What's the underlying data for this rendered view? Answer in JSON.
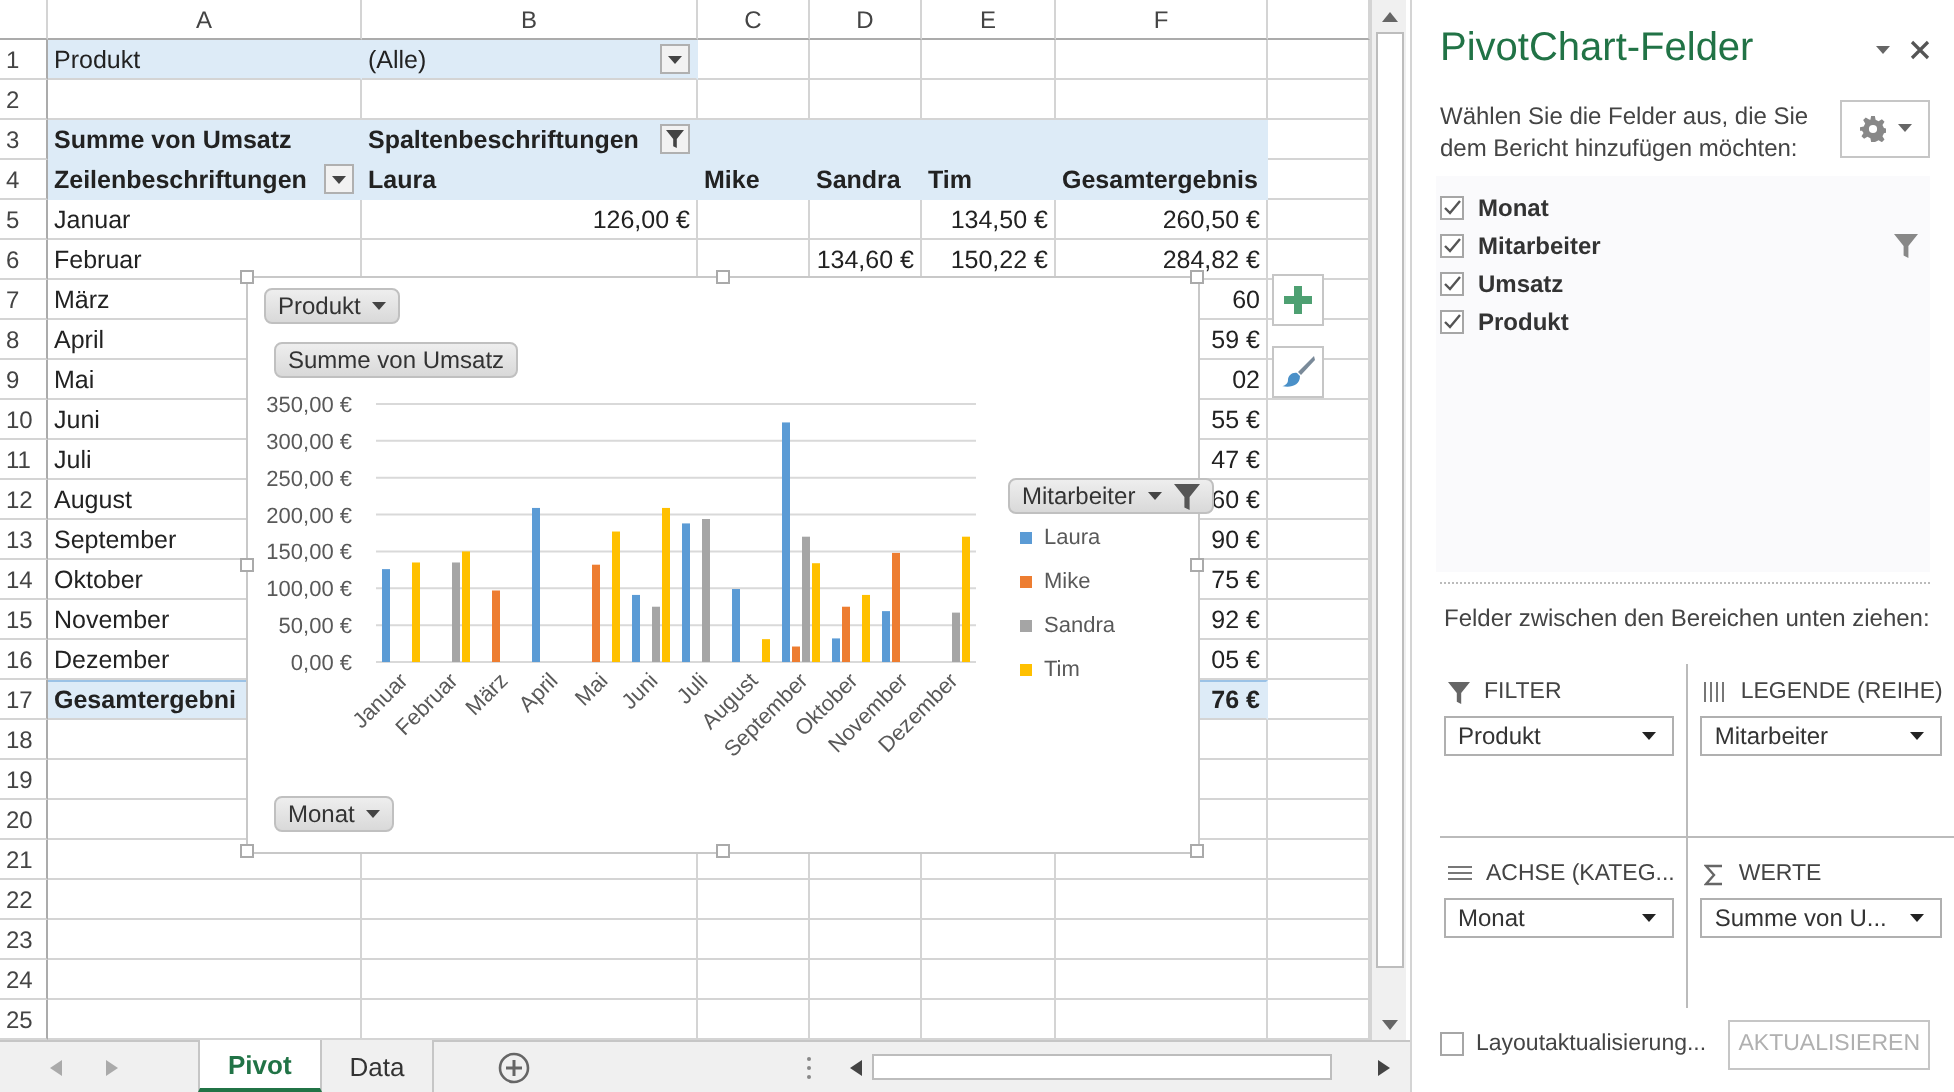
{
  "columns": [
    "A",
    "B",
    "C",
    "D",
    "E",
    "F"
  ],
  "rows": [
    {
      "number": "1",
      "kind": "filter",
      "cells": {
        "A": {
          "text": "Produkt"
        },
        "B": {
          "text": "(Alle)",
          "dropdown": true
        }
      }
    },
    {
      "number": "2",
      "kind": "blank"
    },
    {
      "number": "3",
      "kind": "header",
      "cells": {
        "A": {
          "text": "Summe von Umsatz"
        },
        "B": {
          "text": "Spaltenbeschriftungen",
          "filter_button": true
        }
      }
    },
    {
      "number": "4",
      "kind": "header",
      "cells": {
        "A": {
          "text": "Zeilenbeschriftungen",
          "dropdown": true
        },
        "B": {
          "text": "Laura"
        },
        "C": {
          "text": "Mike"
        },
        "D": {
          "text": "Sandra"
        },
        "E": {
          "text": "Tim"
        },
        "F": {
          "text": "Gesamtergebnis"
        }
      }
    },
    {
      "number": "5",
      "kind": "data",
      "cells": {
        "A": {
          "text": "Januar"
        },
        "B": {
          "text": "126,00 €"
        },
        "E": {
          "text": "134,50 €"
        },
        "F": {
          "text": "260,50 €"
        }
      }
    },
    {
      "number": "6",
      "kind": "data",
      "cells": {
        "A": {
          "text": "Februar"
        },
        "D": {
          "text": "134,60 €"
        },
        "E": {
          "text": "150,22 €"
        },
        "F": {
          "text": "284,82 €"
        }
      }
    },
    {
      "number": "7",
      "kind": "data",
      "cells": {
        "A": {
          "text": "März"
        },
        "F": {
          "text": "60"
        }
      }
    },
    {
      "number": "8",
      "kind": "data",
      "cells": {
        "A": {
          "text": "April"
        },
        "F": {
          "text": "59 €"
        }
      }
    },
    {
      "number": "9",
      "kind": "data",
      "cells": {
        "A": {
          "text": "Mai"
        },
        "F": {
          "text": "02"
        }
      }
    },
    {
      "number": "10",
      "kind": "data",
      "cells": {
        "A": {
          "text": "Juni"
        },
        "F": {
          "text": "55 €"
        }
      }
    },
    {
      "number": "11",
      "kind": "data",
      "cells": {
        "A": {
          "text": "Juli"
        },
        "F": {
          "text": "47 €"
        }
      }
    },
    {
      "number": "12",
      "kind": "data",
      "cells": {
        "A": {
          "text": "August"
        },
        "F": {
          "text": "60 €"
        }
      }
    },
    {
      "number": "13",
      "kind": "data",
      "cells": {
        "A": {
          "text": "September"
        },
        "F": {
          "text": "90 €"
        }
      }
    },
    {
      "number": "14",
      "kind": "data",
      "cells": {
        "A": {
          "text": "Oktober"
        },
        "F": {
          "text": "75 €"
        }
      }
    },
    {
      "number": "15",
      "kind": "data",
      "cells": {
        "A": {
          "text": "November"
        },
        "F": {
          "text": "92 €"
        }
      }
    },
    {
      "number": "16",
      "kind": "data",
      "cells": {
        "A": {
          "text": "Dezember"
        },
        "F": {
          "text": "05 €"
        }
      }
    },
    {
      "number": "17",
      "kind": "total",
      "cells": {
        "A": {
          "text": "Gesamtergebni"
        },
        "F": {
          "text": "76 €"
        }
      }
    },
    {
      "number": "18",
      "kind": "blank"
    },
    {
      "number": "19",
      "kind": "blank"
    },
    {
      "number": "20",
      "kind": "blank"
    },
    {
      "number": "21",
      "kind": "blank"
    },
    {
      "number": "22",
      "kind": "blank"
    },
    {
      "number": "23",
      "kind": "blank"
    },
    {
      "number": "24",
      "kind": "blank"
    },
    {
      "number": "25",
      "kind": "blank"
    }
  ],
  "chart": {
    "field_buttons": [
      {
        "kind": "filter",
        "label": "Produkt"
      },
      {
        "kind": "values",
        "label": "Summe von Umsatz"
      },
      {
        "kind": "legend",
        "label": "Mitarbeiter"
      },
      {
        "kind": "axis",
        "label": "Monat"
      }
    ],
    "chart_data": {
      "type": "bar",
      "categories": [
        "Januar",
        "Februar",
        "März",
        "April",
        "Mai",
        "Juni",
        "Juli",
        "August",
        "September",
        "Oktober",
        "November",
        "Dezember"
      ],
      "series": [
        {
          "name": "Laura",
          "color": "#5b9bd5",
          "values": [
            126,
            null,
            null,
            209,
            null,
            91,
            188,
            99,
            325,
            32,
            69,
            null
          ]
        },
        {
          "name": "Mike",
          "color": "#ed7d31",
          "values": [
            null,
            null,
            97,
            null,
            132,
            null,
            null,
            null,
            21,
            75,
            148,
            null
          ]
        },
        {
          "name": "Sandra",
          "color": "#a5a5a5",
          "values": [
            null,
            135,
            null,
            null,
            null,
            75,
            194,
            null,
            170,
            null,
            null,
            67
          ]
        },
        {
          "name": "Tim",
          "color": "#ffc000",
          "values": [
            135,
            150,
            null,
            null,
            177,
            209,
            null,
            31,
            134,
            91,
            null,
            170
          ]
        }
      ],
      "ylim": [
        0,
        350
      ],
      "yticks": [
        {
          "value": 0,
          "label": "0,00 €"
        },
        {
          "value": 50,
          "label": "50,00 €"
        },
        {
          "value": 100,
          "label": "100,00 €"
        },
        {
          "value": 150,
          "label": "150,00 €"
        },
        {
          "value": 200,
          "label": "200,00 €"
        },
        {
          "value": 250,
          "label": "250,00 €"
        },
        {
          "value": 300,
          "label": "300,00 €"
        },
        {
          "value": 350,
          "label": "350,00 €"
        }
      ],
      "grid": true,
      "legend": true
    }
  },
  "sheet_tabs": [
    {
      "label": "Pivot",
      "selected": true
    },
    {
      "label": "Data",
      "selected": false
    }
  ],
  "field_list": {
    "title": "PivotChart-Felder",
    "instruction": "Wählen Sie die Felder aus, die Sie dem Bericht hinzufügen möchten:",
    "fields": [
      {
        "label": "Monat",
        "checked": true,
        "filtered": false
      },
      {
        "label": "Mitarbeiter",
        "checked": true,
        "filtered": true
      },
      {
        "label": "Umsatz",
        "checked": true,
        "filtered": false
      },
      {
        "label": "Produkt",
        "checked": true,
        "filtered": false
      }
    ],
    "drag_hint": "Felder zwischen den Bereichen unten ziehen:",
    "areas": [
      {
        "kind": "filter",
        "title": "FILTER",
        "items": [
          "Produkt"
        ]
      },
      {
        "kind": "legend",
        "title": "LEGENDE (REIHE)",
        "items": [
          "Mitarbeiter"
        ]
      },
      {
        "kind": "axis",
        "title": "ACHSE (KATEG...",
        "items": [
          "Monat"
        ]
      },
      {
        "kind": "values",
        "title": "WERTE",
        "items": [
          "Summe von U..."
        ]
      }
    ],
    "defer_update": {
      "label": "Layoutaktualisierung...",
      "checked": false
    },
    "update_button": {
      "label": "AKTUALISIEREN",
      "disabled": true
    }
  }
}
